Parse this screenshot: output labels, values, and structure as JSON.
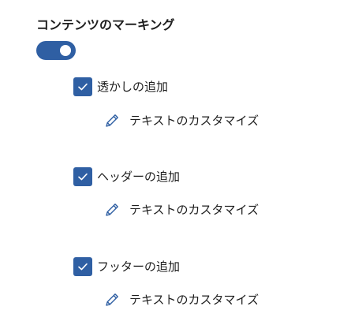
{
  "section": {
    "title": "コンテンツのマーキング",
    "toggle": {
      "on": true
    }
  },
  "options": [
    {
      "label": "透かしの追加",
      "checked": true,
      "customize_label": "テキストのカスタマイズ"
    },
    {
      "label": "ヘッダーの追加",
      "checked": true,
      "customize_label": "テキストのカスタマイズ"
    },
    {
      "label": "フッターの追加",
      "checked": true,
      "customize_label": "テキストのカスタマイズ"
    }
  ],
  "colors": {
    "accent": "#2f5fa3",
    "text": "#1f1f1f"
  }
}
